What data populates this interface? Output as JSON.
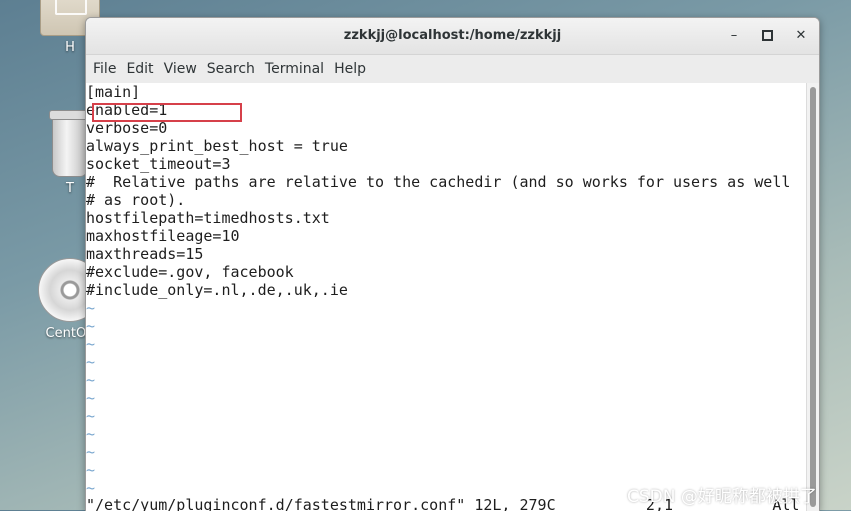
{
  "desktop": {
    "icons": [
      {
        "label": "H"
      },
      {
        "label": "T"
      },
      {
        "label": "CentOS"
      }
    ]
  },
  "window": {
    "title": "zzkkjj@localhost:/home/zzkkjj",
    "minimize_glyph": "–",
    "close_glyph": "✕"
  },
  "menubar": {
    "items": [
      "File",
      "Edit",
      "View",
      "Search",
      "Terminal",
      "Help"
    ]
  },
  "terminal": {
    "lines": [
      "[main]",
      "enabled=1",
      "verbose=0",
      "always_print_best_host = true",
      "socket_timeout=3",
      "#  Relative paths are relative to the cachedir (and so works for users as well",
      "# as root).",
      "hostfilepath=timedhosts.txt",
      "maxhostfileage=10",
      "maxthreads=15",
      "#exclude=.gov, facebook",
      "#include_only=.nl,.de,.uk,.ie"
    ],
    "tildes": [
      "~",
      "~",
      "~",
      "~",
      "~",
      "~",
      "~",
      "~",
      "~",
      "~",
      "~"
    ],
    "status": "\"/etc/yum/pluginconf.d/fastestmirror.conf\" 12L, 279C          2,1           All"
  },
  "annotation": {
    "color": "#d6404a"
  },
  "watermark": "CSDN @好昵称都被拱了"
}
